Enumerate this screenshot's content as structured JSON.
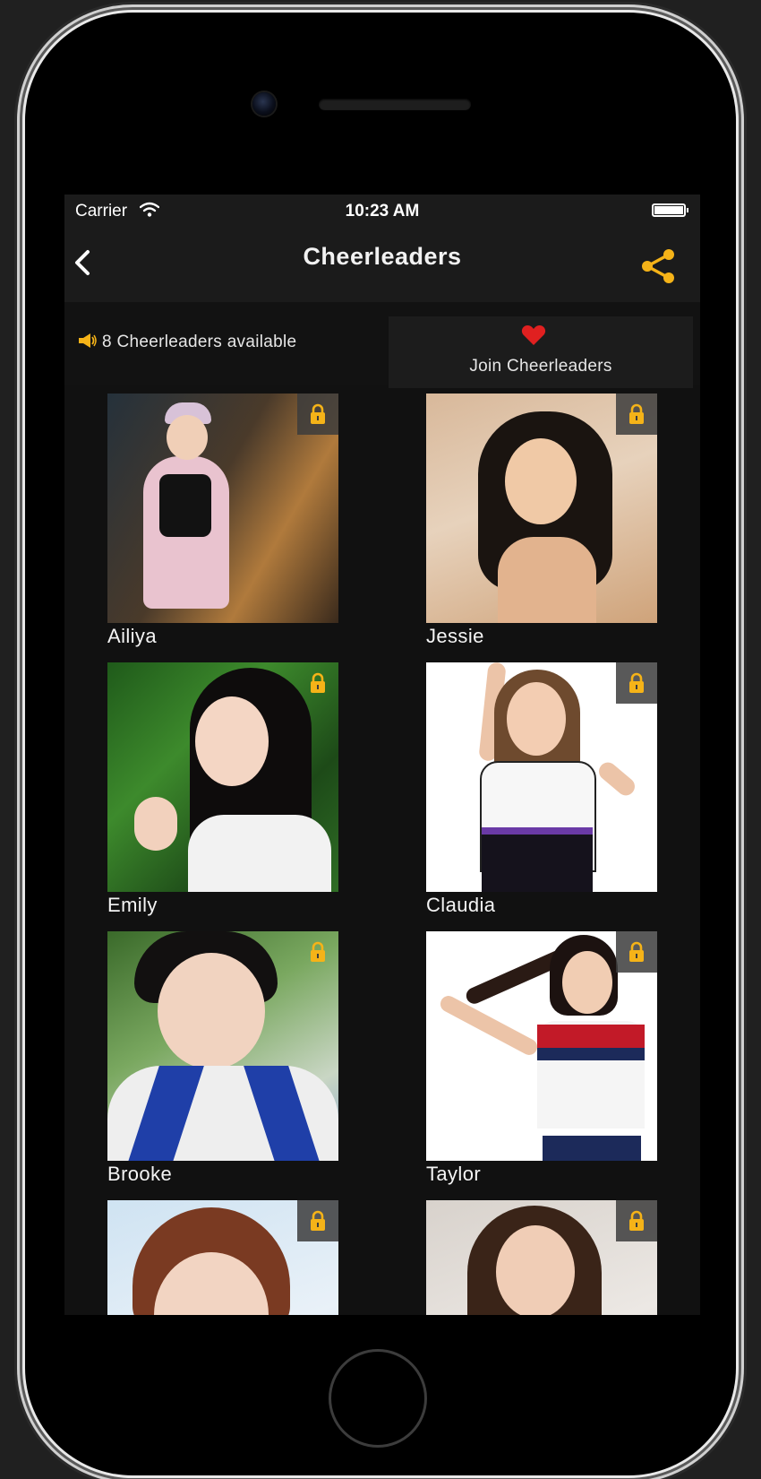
{
  "status_bar": {
    "carrier": "Carrier",
    "time": "10:23 AM"
  },
  "nav": {
    "title": "Cheerleaders"
  },
  "info": {
    "available_text": "8 Cheerleaders available",
    "join_label": "Join Cheerleaders"
  },
  "colors": {
    "accent": "#f5b318",
    "heart": "#e02020",
    "background": "#111111",
    "bar": "#1b1b1b"
  },
  "icons": {
    "back": "chevron-left-icon",
    "share": "share-icon",
    "megaphone": "megaphone-icon",
    "heart": "heart-icon",
    "lock": "lock-icon",
    "wifi": "wifi-icon",
    "battery": "battery-icon"
  },
  "cheerleaders": [
    {
      "name": "Ailiya",
      "locked": true
    },
    {
      "name": "Jessie",
      "locked": true
    },
    {
      "name": "Emily",
      "locked": true
    },
    {
      "name": "Claudia",
      "locked": true
    },
    {
      "name": "Brooke",
      "locked": true
    },
    {
      "name": "Taylor",
      "locked": true
    },
    {
      "name": "",
      "locked": true
    },
    {
      "name": "",
      "locked": true
    }
  ]
}
